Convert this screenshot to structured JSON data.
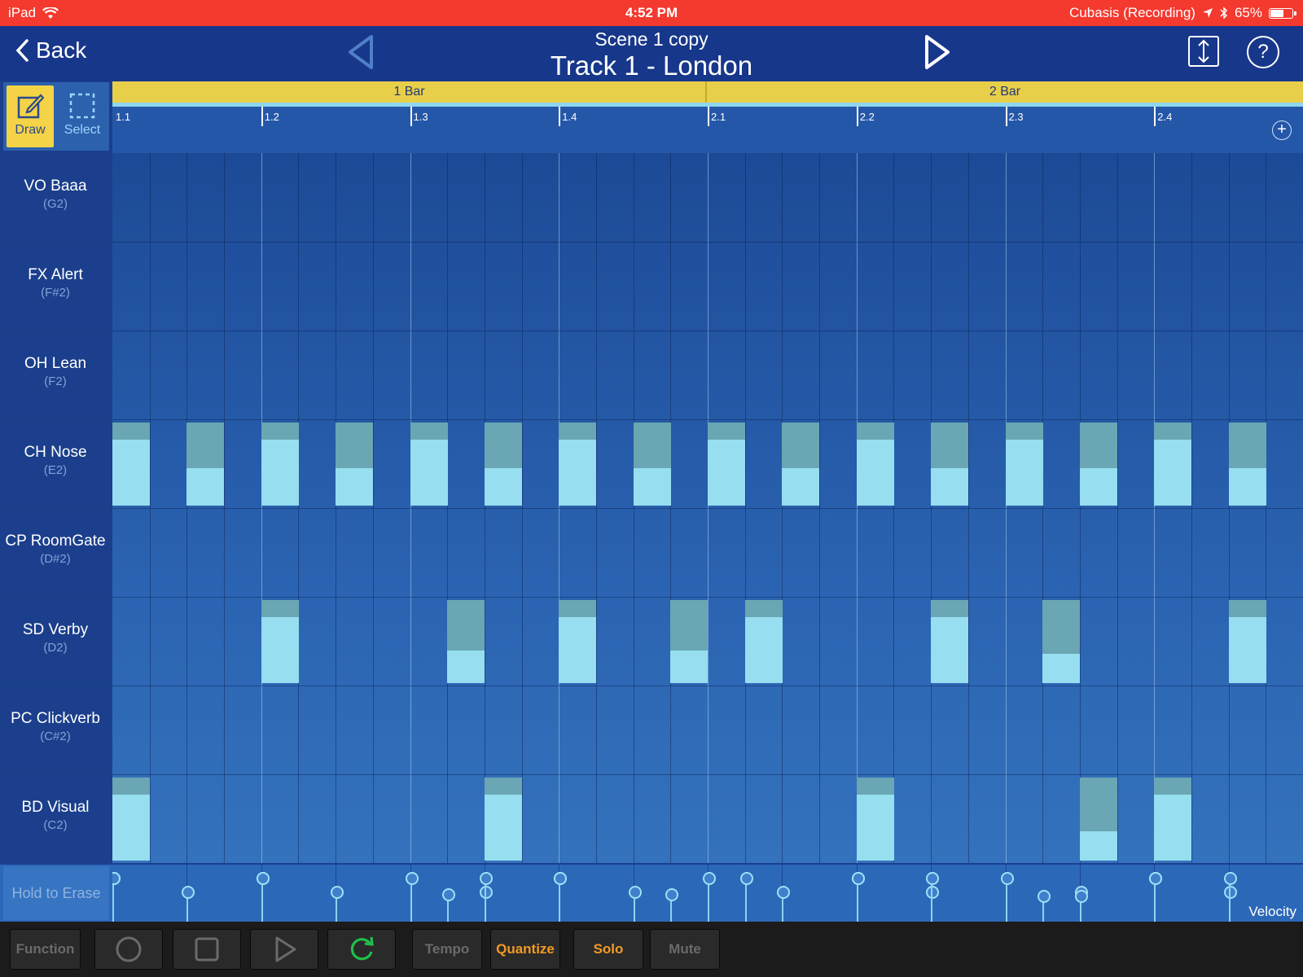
{
  "status_bar": {
    "device": "iPad",
    "time": "4:52 PM",
    "app_status": "Cubasis (Recording)",
    "battery": "65%",
    "battery_level": 0.65
  },
  "nav": {
    "back_label": "Back",
    "scene_title": "Scene  1 copy",
    "track_title": "Track 1 - London",
    "help_label": "?"
  },
  "tools": {
    "draw_label": "Draw",
    "select_label": "Select",
    "active": "draw"
  },
  "ruler": {
    "bars": [
      "1 Bar",
      "2 Bar"
    ],
    "beats": [
      "1.1",
      "1.2",
      "1.3",
      "1.4",
      "2.1",
      "2.2",
      "2.3",
      "2.4"
    ],
    "add_label": "+"
  },
  "lanes": [
    {
      "name": "VO Baaa",
      "note": "(G2)",
      "hits": []
    },
    {
      "name": "FX Alert",
      "note": "(F#2)",
      "hits": []
    },
    {
      "name": "OH Lean",
      "note": "(F2)",
      "hits": []
    },
    {
      "name": "CH Nose",
      "note": "(E2)",
      "hits": [
        {
          "step": 0,
          "velocity": 0.79
        },
        {
          "step": 2,
          "velocity": 0.45
        },
        {
          "step": 4,
          "velocity": 0.79
        },
        {
          "step": 6,
          "velocity": 0.45
        },
        {
          "step": 8,
          "velocity": 0.79
        },
        {
          "step": 10,
          "velocity": 0.45
        },
        {
          "step": 12,
          "velocity": 0.79
        },
        {
          "step": 14,
          "velocity": 0.45
        },
        {
          "step": 16,
          "velocity": 0.79
        },
        {
          "step": 18,
          "velocity": 0.45
        },
        {
          "step": 20,
          "velocity": 0.79
        },
        {
          "step": 22,
          "velocity": 0.45
        },
        {
          "step": 24,
          "velocity": 0.79
        },
        {
          "step": 26,
          "velocity": 0.45
        },
        {
          "step": 28,
          "velocity": 0.79
        },
        {
          "step": 30,
          "velocity": 0.45
        }
      ]
    },
    {
      "name": "CP RoomGate",
      "note": "(D#2)",
      "hits": []
    },
    {
      "name": "SD Verby",
      "note": "(D2)",
      "hits": [
        {
          "step": 4,
          "velocity": 0.79
        },
        {
          "step": 9,
          "velocity": 0.39
        },
        {
          "step": 12,
          "velocity": 0.79
        },
        {
          "step": 15,
          "velocity": 0.39
        },
        {
          "step": 17,
          "velocity": 0.79
        },
        {
          "step": 22,
          "velocity": 0.79
        },
        {
          "step": 25,
          "velocity": 0.35
        },
        {
          "step": 30,
          "velocity": 0.79
        }
      ]
    },
    {
      "name": "PC Clickverb",
      "note": "(C#2)",
      "hits": []
    },
    {
      "name": "BD Visual",
      "note": "(C2)",
      "hits": [
        {
          "step": 0,
          "velocity": 0.79
        },
        {
          "step": 10,
          "velocity": 0.79
        },
        {
          "step": 20,
          "velocity": 0.79
        },
        {
          "step": 26,
          "velocity": 0.35
        },
        {
          "step": 28,
          "velocity": 0.79
        }
      ]
    }
  ],
  "velocity_lane": {
    "erase_label": "Hold to Erase",
    "label": "Velocity"
  },
  "transport": {
    "function_label": "Function",
    "tempo_label": "Tempo",
    "quantize_label": "Quantize",
    "solo_label": "Solo",
    "mute_label": "Mute"
  },
  "colors": {
    "status_bar": "#f4392f",
    "draw_tool": "#f5d347",
    "note_fill": "#96def0",
    "note_dim": "#6aa6b3",
    "accent_orange": "#f39a22",
    "loop_green": "#1fbf4a"
  }
}
